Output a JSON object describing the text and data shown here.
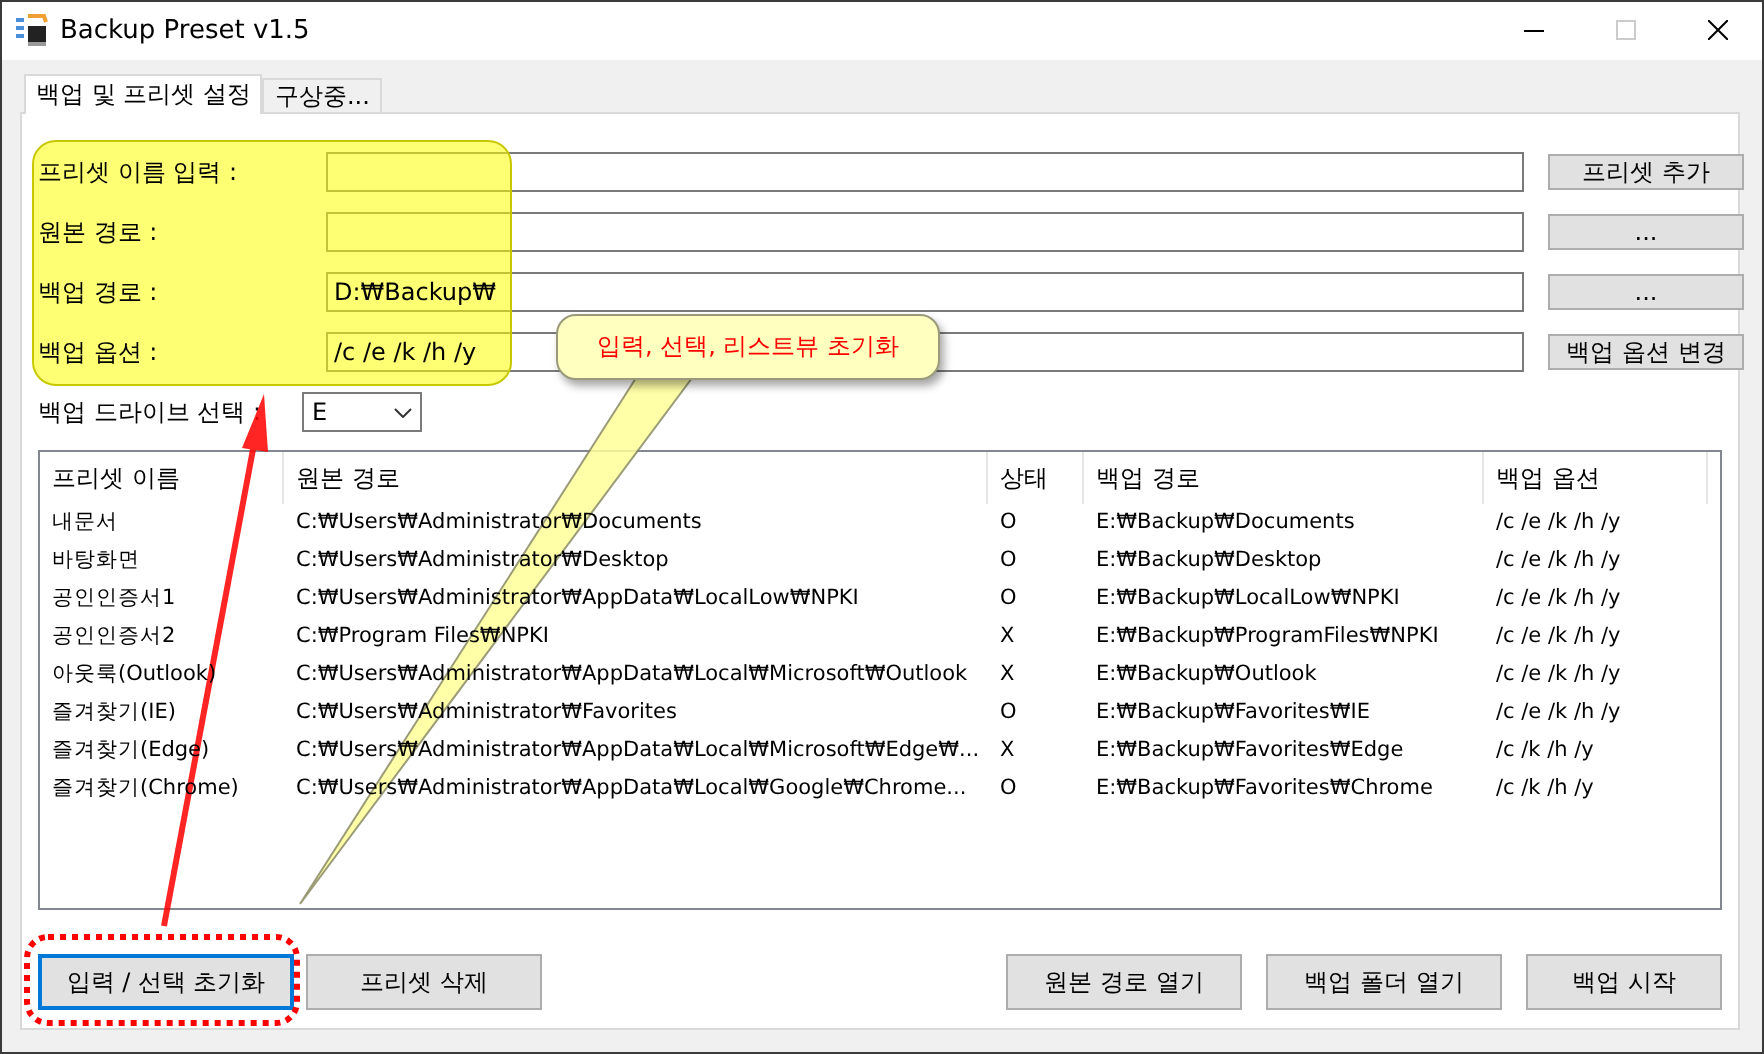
{
  "window": {
    "title": "Backup Preset v1.5"
  },
  "tabs": [
    {
      "label": "백업 및 프리셋 설정",
      "selected": true
    },
    {
      "label": "구상중...",
      "selected": false
    }
  ],
  "form": [
    {
      "label": "프리셋 이름 입력 :",
      "button": "프리셋 추가"
    },
    {
      "label": "원본 경로 :",
      "button": "..."
    },
    {
      "label": "백업 경로 :",
      "value": "D:₩Backup₩",
      "button": "..."
    },
    {
      "label": "백업 옵션 :",
      "value": "/c /e /k /h /y",
      "button": "백업 옵션 변경"
    }
  ],
  "drive": {
    "label": "백업 드라이브 선택 :",
    "value": "E"
  },
  "table": {
    "columns": [
      "프리셋 이름",
      "원본 경로",
      "상태",
      "백업 경로",
      "백업 옵션"
    ],
    "rows": [
      [
        "내문서",
        "C:₩Users₩Administrator₩Documents",
        "O",
        "E:₩Backup₩Documents",
        "/c /e /k /h /y"
      ],
      [
        "바탕화면",
        "C:₩Users₩Administrator₩Desktop",
        "O",
        "E:₩Backup₩Desktop",
        "/c /e /k /h /y"
      ],
      [
        "공인인증서1",
        "C:₩Users₩Administrator₩AppData₩LocalLow₩NPKI",
        "O",
        "E:₩Backup₩LocalLow₩NPKI",
        "/c /e /k /h /y"
      ],
      [
        "공인인증서2",
        "C:₩Program Files₩NPKI",
        "X",
        "E:₩Backup₩ProgramFiles₩NPKI",
        "/c /e /k /h /y"
      ],
      [
        "아웃룩(Outlook)",
        "C:₩Users₩Administrator₩AppData₩Local₩Microsoft₩Outlook",
        "X",
        "E:₩Backup₩Outlook",
        "/c /e /k /h /y"
      ],
      [
        "즐겨찾기(IE)",
        "C:₩Users₩Administrator₩Favorites",
        "O",
        "E:₩Backup₩Favorites₩IE",
        "/c /e /k /h /y"
      ],
      [
        "즐겨찾기(Edge)",
        "C:₩Users₩Administrator₩AppData₩Local₩Microsoft₩Edge₩...",
        "X",
        "E:₩Backup₩Favorites₩Edge",
        "/c /k /h /y"
      ],
      [
        "즐겨찾기(Chrome)",
        "C:₩Users₩Administrator₩AppData₩Local₩Google₩Chrome...",
        "O",
        "E:₩Backup₩Favorites₩Chrome",
        "/c /k /h /y"
      ]
    ]
  },
  "buttons_left": [
    {
      "label": "입력 / 선택 초기화",
      "focused": true
    },
    {
      "label": "프리셋 삭제",
      "focused": false
    }
  ],
  "buttons_right": [
    {
      "label": "원본 경로 열기",
      "focused": false
    },
    {
      "label": "백업 폴더 열기",
      "focused": false
    },
    {
      "label": "백업 시작",
      "focused": false
    }
  ],
  "annotation": {
    "callout": "입력, 선택, 리스트뷰 초기화"
  }
}
